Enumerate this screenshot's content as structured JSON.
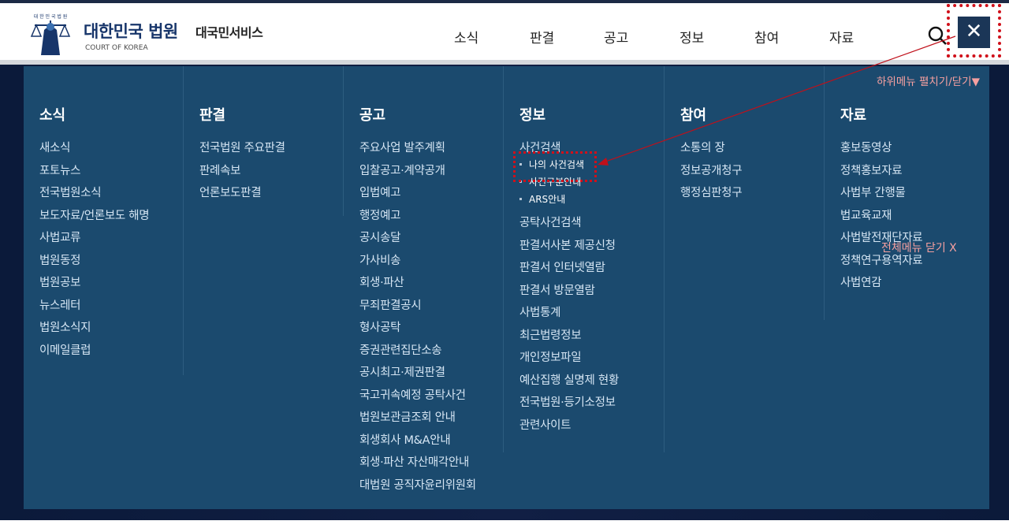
{
  "header": {
    "brand_ko": "대한민국 법원",
    "brand_en": "COURT OF KOREA",
    "emblem_text": "대 한 민 국 법 원",
    "service": "대국민서비스",
    "nav": [
      "소식",
      "판결",
      "공고",
      "정보",
      "참여",
      "자료"
    ],
    "search_icon": "search-icon",
    "close_label": "✕"
  },
  "panel": {
    "submenu_toggle": "하위메뉴 펼치기/닫기▼",
    "close_all": "전체메뉴 닫기 X",
    "columns": [
      {
        "title": "소식",
        "items": [
          "새소식",
          "포토뉴스",
          "전국법원소식",
          "보도자료/언론보도 해명",
          "사법교류",
          "법원동정",
          "법원공보",
          "뉴스레터",
          "법원소식지",
          "이메일클럽"
        ]
      },
      {
        "title": "판결",
        "items": [
          "전국법원 주요판결",
          "판례속보",
          "언론보도판결"
        ]
      },
      {
        "title": "공고",
        "items": [
          "주요사업 발주계획",
          "입찰공고·계약공개",
          "입법예고",
          "행정예고",
          "공시송달",
          "가사비송",
          "회생·파산",
          "무죄판결공시",
          "형사공탁",
          "증권관련집단소송",
          "공시최고·제권판결",
          "국고귀속예정 공탁사건",
          "법원보관금조회 안내",
          "회생회사 M&A안내",
          "회생·파산 자산매각안내",
          "대법원 공직자윤리위원회"
        ]
      },
      {
        "title": "정보",
        "first_item": "사건검색",
        "sub_items": [
          "나의 사건검색",
          "사건구분안내",
          "ARS안내"
        ],
        "items": [
          "공탁사건검색",
          "판결서사본 제공신청",
          "판결서 인터넷열람",
          "판결서 방문열람",
          "사법통계",
          "최근법령정보",
          "개인정보파일",
          "예산집행 실명제 현황",
          "전국법원·등기소정보",
          "관련사이트"
        ]
      },
      {
        "title": "참여",
        "items": [
          "소통의 장",
          "정보공개청구",
          "행정심판청구"
        ]
      },
      {
        "title": "자료",
        "items": [
          "홍보동영상",
          "정책홍보자료",
          "사법부 간행물",
          "법교육교재",
          "사법발전재단자료",
          "정책연구용역자료",
          "사법연감"
        ]
      }
    ]
  },
  "colors": {
    "panel": "#1b4a6e",
    "accent": "#d0101a",
    "close_bg": "#1b3657",
    "link": "#f6a0a0"
  }
}
